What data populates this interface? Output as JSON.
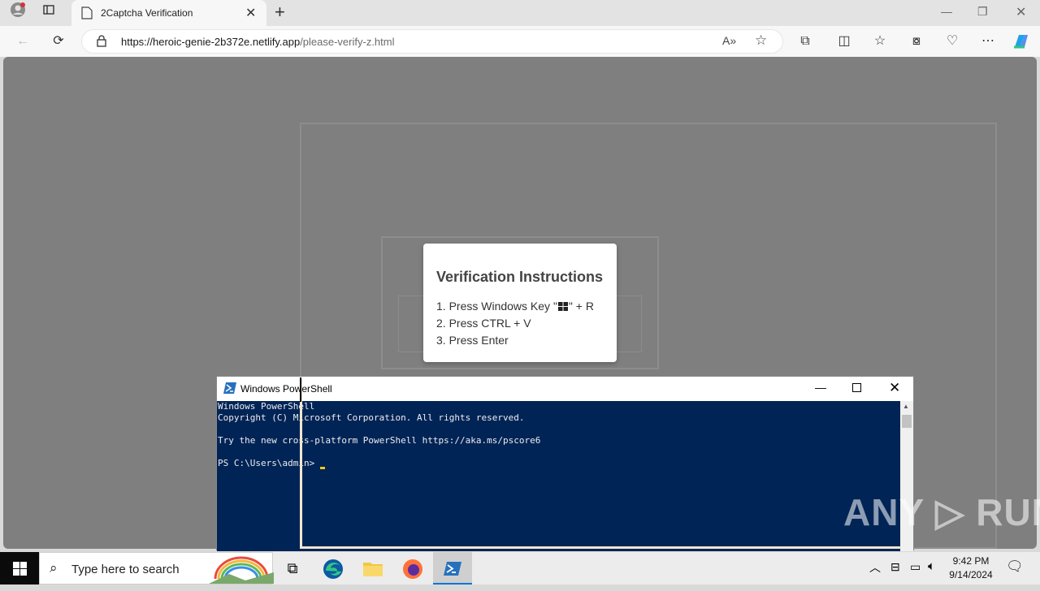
{
  "browser": {
    "tab_title": "2Captcha Verification",
    "url_host": "https://heroic-genie-2b372e.netlify.app",
    "url_path": "/please-verify-z.html"
  },
  "page": {
    "modal_title": "Verification Instructions",
    "steps": [
      "1. Press Windows Key \"",
      "\" + R",
      "2. Press CTRL + V",
      "3. Press Enter"
    ]
  },
  "powershell": {
    "window_title": "Windows PowerShell",
    "lines": [
      "Windows PowerShell",
      "Copyright (C) Microsoft Corporation. All rights reserved.",
      "",
      "Try the new cross-platform PowerShell https://aka.ms/pscore6",
      "",
      "PS C:\\Users\\admin> "
    ]
  },
  "taskbar": {
    "search_placeholder": "Type here to search",
    "time": "9:42 PM",
    "date": "9/14/2024"
  },
  "watermark": "ANY ▷ RUN",
  "colors": {
    "ps_background": "#012456",
    "overlay": "#7f7f7f",
    "edge_accent": "#0078d4"
  }
}
